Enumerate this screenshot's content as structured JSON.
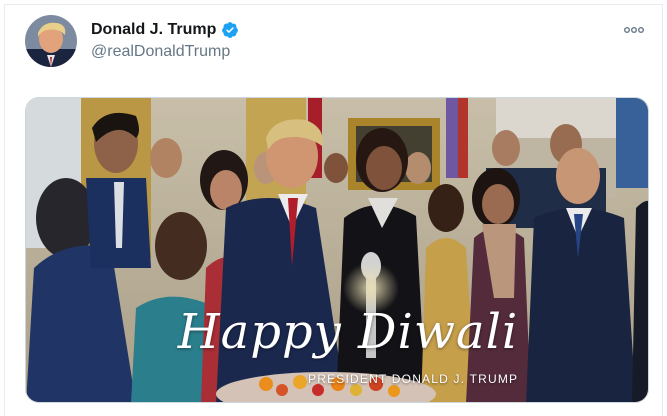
{
  "tweet": {
    "display_name": "Donald J. Trump",
    "handle": "@realDonaldTrump",
    "verified": true,
    "more_icon": "more-dots-icon"
  },
  "media": {
    "caption_script": "Happy Diwali",
    "caption_sub": "PRESIDENT DONALD J. TRUMP"
  },
  "colors": {
    "verified_blue": "#1da1f2",
    "handle_gray": "#657786",
    "name_black": "#14171a"
  }
}
